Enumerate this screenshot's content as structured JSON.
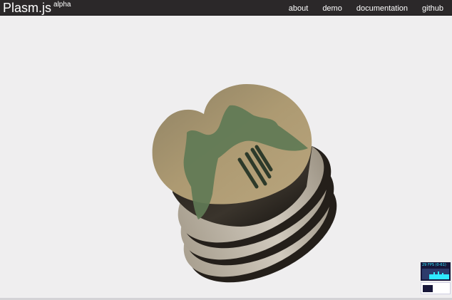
{
  "header": {
    "brand": "Plasm.js",
    "brand_tag": "alpha",
    "nav": [
      {
        "label": "about"
      },
      {
        "label": "demo"
      },
      {
        "label": "documentation"
      },
      {
        "label": "github"
      }
    ]
  },
  "stats_panel": {
    "fps_label": "29 FPS (0-61)"
  },
  "colors": {
    "topbar": "#2b2829",
    "background": "#efeeef",
    "model_top": "#ad9a72",
    "model_patch": "#5f7a55",
    "model_disc": "#b8b0a3",
    "model_shadow": "#2b2621"
  }
}
